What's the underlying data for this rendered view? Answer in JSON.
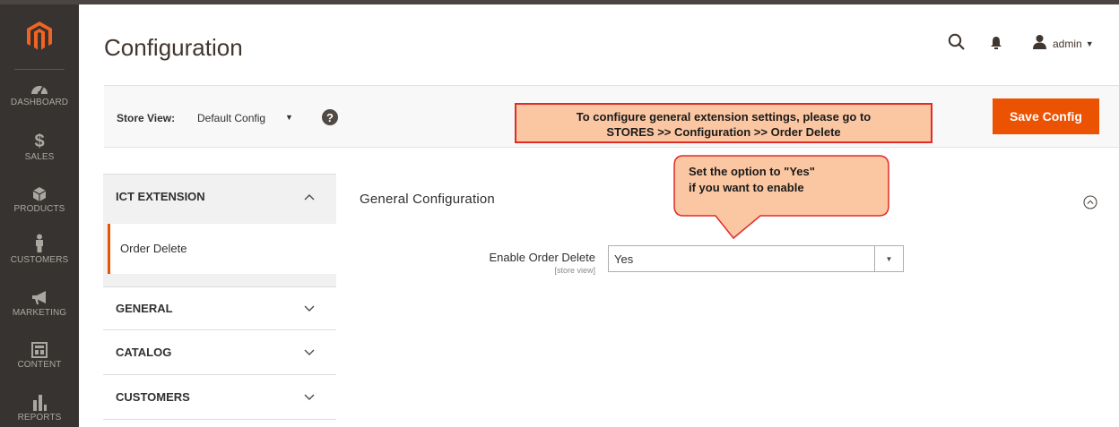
{
  "header": {
    "title": "Configuration",
    "user_name": "admin"
  },
  "sidebar": {
    "logo_icon": "magento-logo-icon",
    "items": [
      {
        "label": "DASHBOARD",
        "icon": "dashboard-icon"
      },
      {
        "label": "SALES",
        "icon": "dollar-icon"
      },
      {
        "label": "PRODUCTS",
        "icon": "cube-icon"
      },
      {
        "label": "CUSTOMERS",
        "icon": "person-icon"
      },
      {
        "label": "MARKETING",
        "icon": "megaphone-icon"
      },
      {
        "label": "CONTENT",
        "icon": "layout-icon"
      },
      {
        "label": "REPORTS",
        "icon": "bar-chart-icon"
      }
    ]
  },
  "store_bar": {
    "label": "Store View:",
    "value": "Default Config",
    "save_label": "Save Config"
  },
  "callout_top": {
    "line1": "To configure general extension settings, please go to",
    "line2": "STORES >> Configuration >>  Order Delete"
  },
  "callout_bubble": {
    "line1": "Set the option to \"Yes\"",
    "line2": "if you want to enable"
  },
  "config_tabs": {
    "ict_extension": "ICT EXTENSION",
    "order_delete": "Order Delete",
    "general": "GENERAL",
    "catalog": "CATALOG",
    "customers": "CUSTOMERS"
  },
  "section": {
    "title": "General Configuration",
    "field_label": "Enable Order Delete",
    "field_scope": "[store view]",
    "field_value": "Yes"
  },
  "colors": {
    "sidebar_bg": "#373330",
    "accent": "#eb5202",
    "callout_fill": "#fbc6a2",
    "callout_border": "#e02b27"
  }
}
